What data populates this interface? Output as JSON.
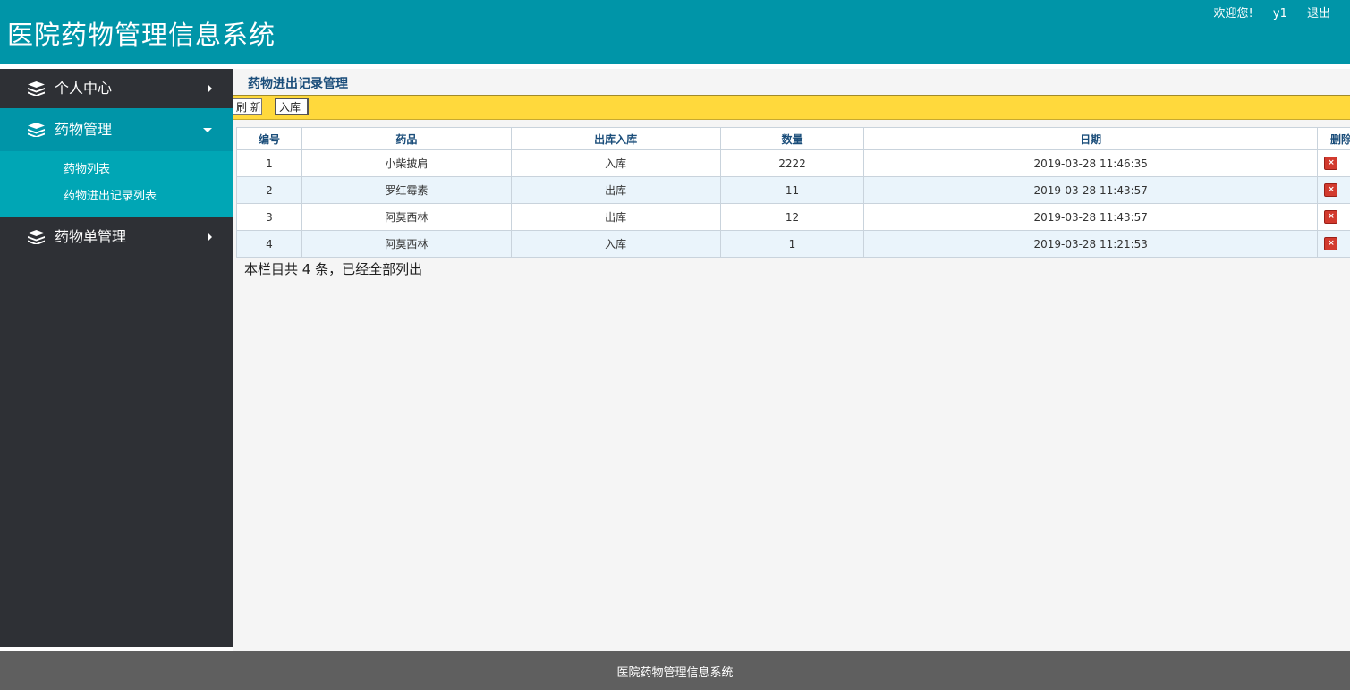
{
  "header": {
    "title": "医院药物管理信息系统",
    "welcome": "欢迎您!",
    "username": "y1",
    "logout": "退出"
  },
  "sidebar": {
    "items": [
      {
        "label": "个人中心",
        "icon": "stack-icon",
        "expanded": false
      },
      {
        "label": "药物管理",
        "icon": "stack-icon",
        "expanded": true,
        "children": [
          {
            "label": "药物列表"
          },
          {
            "label": "药物进出记录列表"
          }
        ]
      },
      {
        "label": "药物单管理",
        "icon": "stack-icon",
        "expanded": false
      }
    ]
  },
  "main": {
    "title": "药物进出记录管理",
    "toolbar": {
      "refresh_label": "刷 新",
      "in_label": "入库"
    },
    "table": {
      "columns": [
        "编号",
        "药品",
        "出库入库",
        "数量",
        "日期",
        "删除"
      ],
      "rows": [
        {
          "id": "1",
          "drug": "小柴披肩",
          "type": "入库",
          "qty": "2222",
          "date": "2019-03-28 11:46:35"
        },
        {
          "id": "2",
          "drug": "罗红霉素",
          "type": "出库",
          "qty": "11",
          "date": "2019-03-28 11:43:57"
        },
        {
          "id": "3",
          "drug": "阿莫西林",
          "type": "出库",
          "qty": "12",
          "date": "2019-03-28 11:43:57"
        },
        {
          "id": "4",
          "drug": "阿莫西林",
          "type": "入库",
          "qty": "1",
          "date": "2019-03-28 11:21:53"
        }
      ]
    },
    "summary": "本栏目共 4 条，已经全部列出"
  },
  "footer": {
    "text": "医院药物管理信息系统"
  },
  "colors": {
    "header_bg": "#0095a8",
    "sidebar_bg": "#2e3035",
    "submenu_bg": "#00a6b5",
    "toolbar_bg": "#ffd93c",
    "footer_bg": "#5f5f5f",
    "delete_icon": "#d23a2e"
  }
}
